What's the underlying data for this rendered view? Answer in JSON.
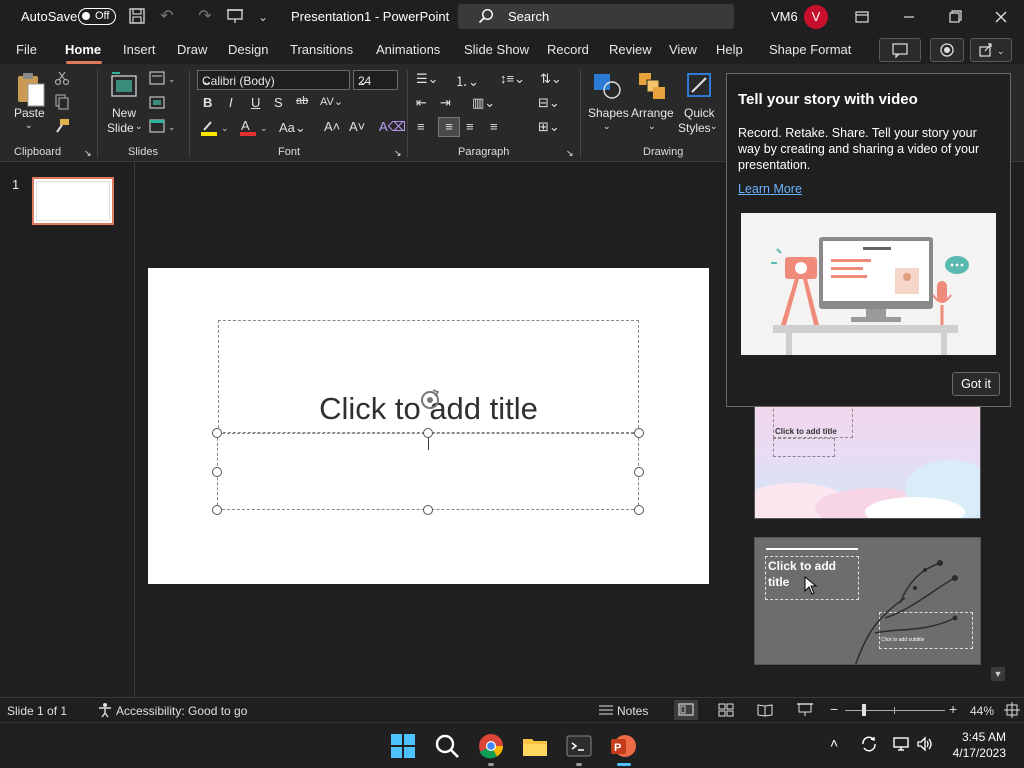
{
  "titlebar": {
    "autosave_label": "AutoSave",
    "autosave_state": "Off",
    "doc_title": "Presentation1  -  PowerPoint",
    "search_placeholder": "Search",
    "user_initials": "VM6",
    "avatar_letter": "V"
  },
  "menu": {
    "items": [
      "File",
      "Home",
      "Insert",
      "Draw",
      "Design",
      "Transitions",
      "Animations",
      "Slide Show",
      "Record",
      "Review",
      "View",
      "Help",
      "Shape Format"
    ],
    "active": "Home"
  },
  "ribbon": {
    "clipboard": {
      "paste_label": "Paste",
      "group_label": "Clipboard"
    },
    "slides": {
      "new_slide_line1": "New",
      "new_slide_line2": "Slide",
      "group_label": "Slides"
    },
    "font": {
      "font_name": "Calibri (Body)",
      "font_size": "24",
      "group_label": "Font"
    },
    "paragraph": {
      "group_label": "Paragraph"
    },
    "drawing": {
      "shapes_label": "Shapes",
      "arrange_label": "Arrange",
      "quick_styles_line1": "Quick",
      "quick_styles_line2": "Styles",
      "group_label": "Drawing"
    }
  },
  "thumbnails": {
    "slide_number": "1"
  },
  "slide": {
    "title_placeholder": "Click to add title"
  },
  "popup": {
    "title": "Tell your story with video",
    "body": "Record. Retake. Share. Tell your story your way by creating and sharing a video of your presentation.",
    "link": "Learn More",
    "button": "Got it"
  },
  "designer": {
    "card1_title": "Click to add title",
    "card2_title": "Click to add title",
    "card_subtitle": "Click to add subtitle"
  },
  "statusbar": {
    "slide_info": "Slide 1 of 1",
    "accessibility": "Accessibility: Good to go",
    "notes_label": "Notes",
    "zoom": "44%"
  },
  "taskbar": {
    "time": "3:45 AM",
    "date": "4/17/2023"
  },
  "colors": {
    "accent": "#e07a5f",
    "avatar": "#c8102e",
    "link": "#6cb4ff"
  }
}
